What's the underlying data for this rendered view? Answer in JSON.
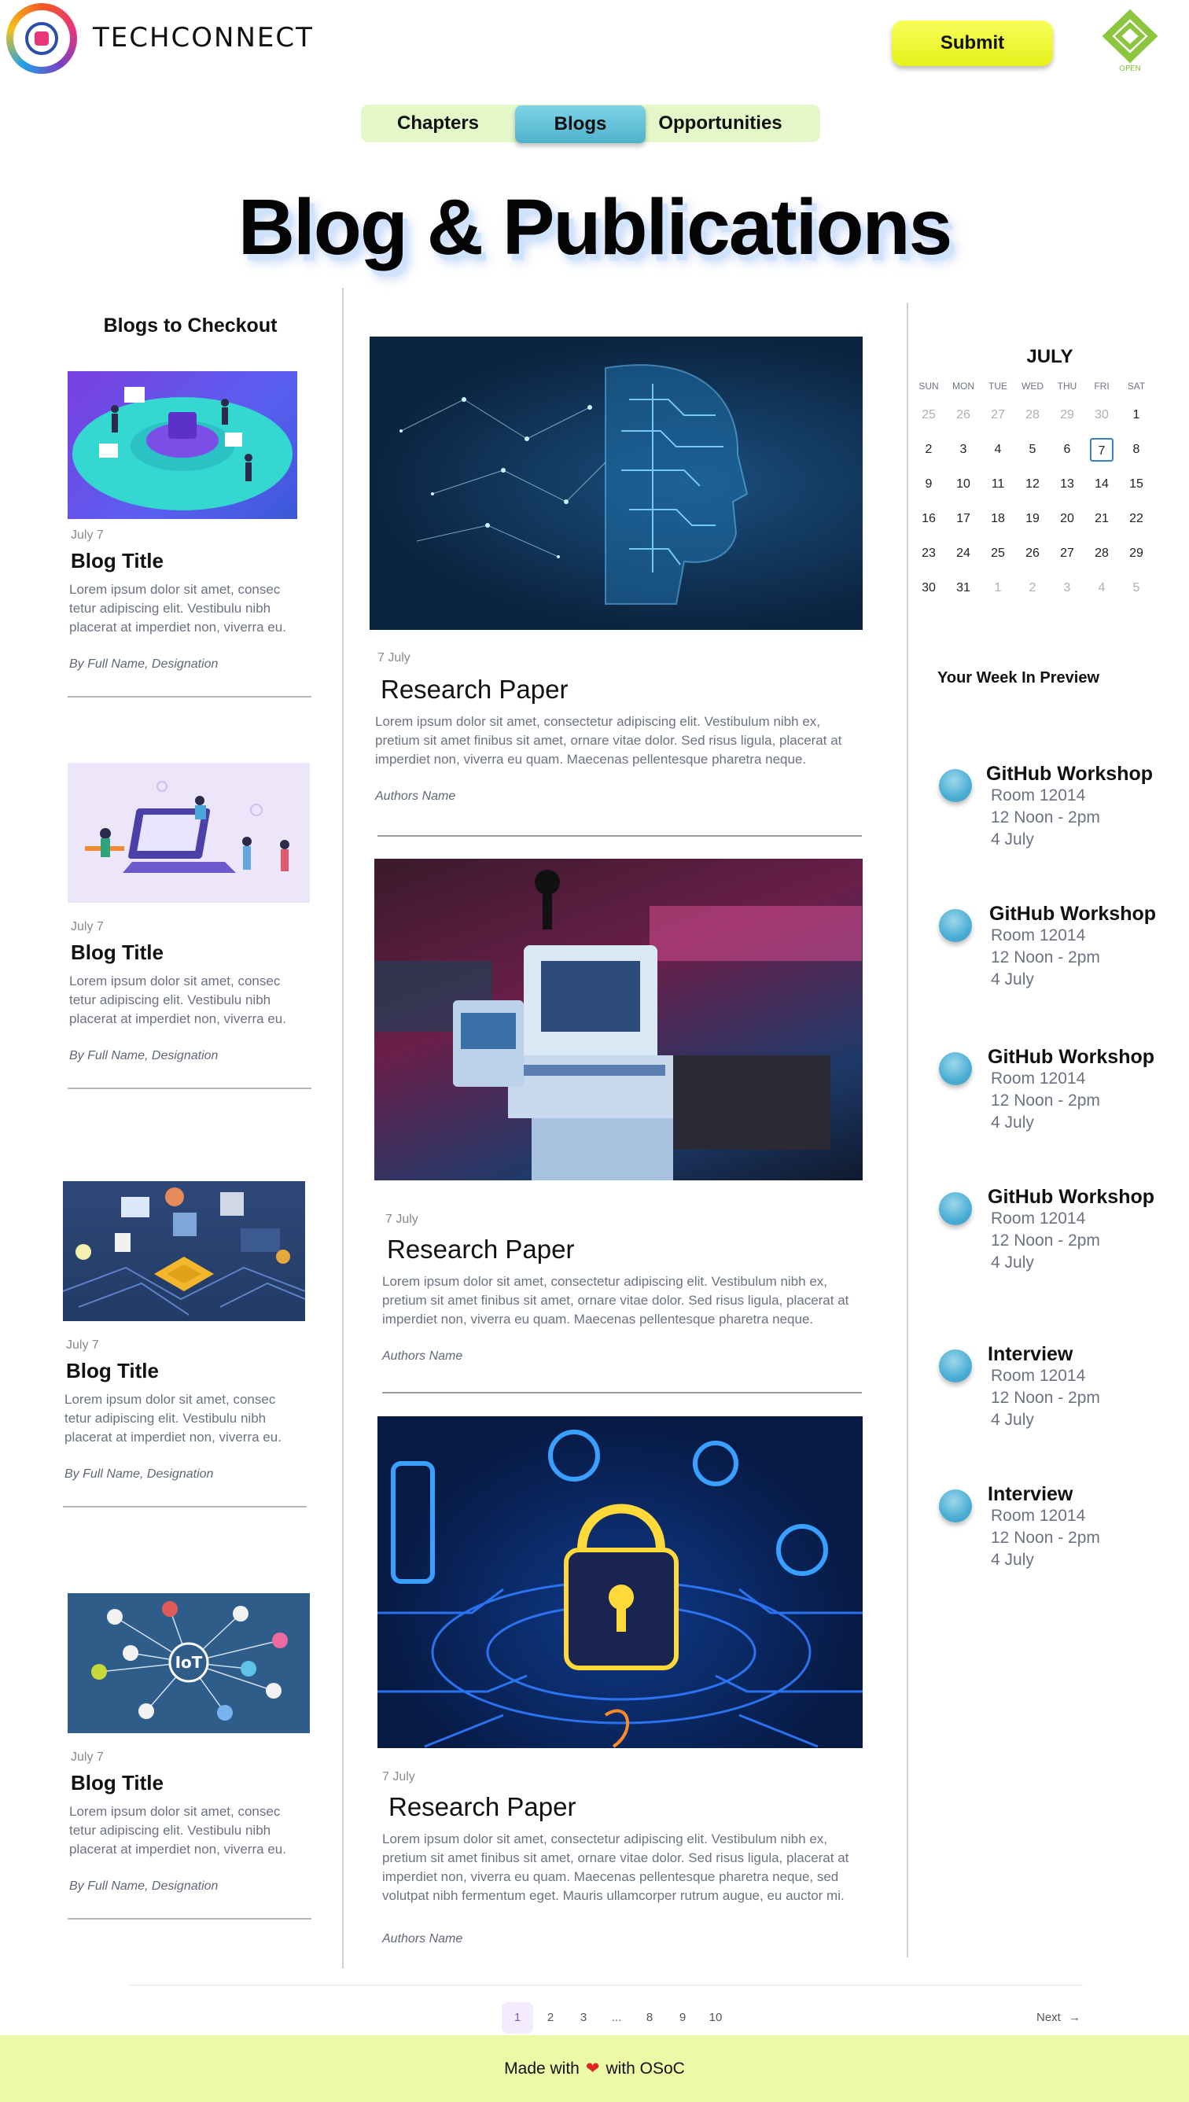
{
  "header": {
    "brand": "TECHCONNECT",
    "submit_label": "Submit",
    "open_logo_text": "OPEN"
  },
  "nav": {
    "tabs": [
      {
        "label": "Chapters",
        "active": false
      },
      {
        "label": "Blogs",
        "active": true
      },
      {
        "label": "Opportunities",
        "active": false
      }
    ]
  },
  "page_title": "Blog & Publications",
  "sidebar": {
    "heading": "Blogs to Checkout",
    "blogs": [
      {
        "date": "July 7",
        "title": "Blog Title",
        "description": "Lorem ipsum dolor sit amet, consec tetur adipiscing elit. Vestibulu nibh placerat at imperdiet non, viverra eu.",
        "author": "By Full Name, Designation"
      },
      {
        "date": "July 7",
        "title": "Blog Title",
        "description": "Lorem ipsum dolor sit amet, consec tetur adipiscing elit. Vestibulu nibh placerat at imperdiet non, viverra eu.",
        "author": "By Full Name, Designation"
      },
      {
        "date": "July 7",
        "title": "Blog Title",
        "description": "Lorem ipsum dolor sit amet, consec tetur adipiscing elit. Vestibulu nibh placerat at imperdiet non, viverra eu.",
        "author": "By Full Name, Designation"
      },
      {
        "date": "July 7",
        "title": "Blog Title",
        "description": "Lorem ipsum dolor sit amet, consec tetur adipiscing elit. Vestibulu nibh placerat at imperdiet non, viverra eu.",
        "author": "By Full Name, Designation"
      }
    ]
  },
  "papers": [
    {
      "date": "7 July",
      "title": "Research Paper",
      "description": "Lorem ipsum dolor sit amet, consectetur adipiscing elit. Vestibulum nibh ex, pretium sit amet finibus sit amet, ornare vitae dolor. Sed risus ligula, placerat at imperdiet non, viverra eu quam. Maecenas pellentesque pharetra neque.",
      "author": "Authors Name"
    },
    {
      "date": "7 July",
      "title": "Research Paper",
      "description": "Lorem ipsum dolor sit amet, consectetur adipiscing elit. Vestibulum nibh ex, pretium sit amet finibus sit amet, ornare vitae dolor. Sed risus ligula, placerat at imperdiet non, viverra eu quam. Maecenas pellentesque pharetra neque.",
      "author": "Authors Name"
    },
    {
      "date": "7 July",
      "title": "Research Paper",
      "description": "Lorem ipsum dolor sit amet, consectetur adipiscing elit. Vestibulum nibh ex, pretium sit amet finibus sit amet, ornare vitae dolor. Sed risus ligula, placerat at imperdiet non, viverra eu quam. Maecenas pellentesque pharetra neque, sed volutpat nibh fermentum eget. Mauris ullamcorper rutrum augue, eu auctor mi.",
      "author": "Authors Name"
    }
  ],
  "calendar": {
    "month": "JULY",
    "weekdays": [
      "SUN",
      "MON",
      "TUE",
      "WED",
      "THU",
      "FRI",
      "SAT"
    ],
    "weeks": [
      [
        "25",
        "26",
        "27",
        "28",
        "29",
        "30",
        "1"
      ],
      [
        "2",
        "3",
        "4",
        "5",
        "6",
        "7",
        "8"
      ],
      [
        "9",
        "10",
        "11",
        "12",
        "13",
        "14",
        "15"
      ],
      [
        "16",
        "17",
        "18",
        "19",
        "20",
        "21",
        "22"
      ],
      [
        "23",
        "24",
        "25",
        "26",
        "27",
        "28",
        "29"
      ],
      [
        "30",
        "31",
        "1",
        "2",
        "3",
        "4",
        "5"
      ]
    ],
    "today": "7"
  },
  "week_preview": {
    "title": "Your Week In Preview",
    "events": [
      {
        "name": "GitHub Workshop",
        "room": "Room 12014",
        "time": "12 Noon - 2pm",
        "date": "4 July"
      },
      {
        "name": "GitHub Workshop",
        "room": "Room 12014",
        "time": "12 Noon - 2pm",
        "date": "4 July"
      },
      {
        "name": "GitHub Workshop",
        "room": "Room 12014",
        "time": "12 Noon - 2pm",
        "date": "4 July"
      },
      {
        "name": "GitHub Workshop",
        "room": "Room 12014",
        "time": "12 Noon - 2pm",
        "date": "4 July"
      },
      {
        "name": "Interview",
        "room": "Room 12014",
        "time": "12 Noon - 2pm",
        "date": "4 July"
      },
      {
        "name": "Interview",
        "room": "Room 12014",
        "time": "12 Noon - 2pm",
        "date": "4 July"
      }
    ]
  },
  "pagination": {
    "pages": [
      "1",
      "2",
      "3",
      "...",
      "8",
      "9",
      "10"
    ],
    "current": "1",
    "next_label": "Next",
    "next_icon": "arrow-right-icon"
  },
  "footer": {
    "before": "Made with",
    "icon": "heart-icon",
    "after": "with OSoC"
  },
  "colors": {
    "submit": "#e6f11b",
    "nav_bg": "#e3f7c8",
    "nav_active": "#4fb2cc",
    "footer_bg": "#ecfaa8",
    "pagination_active": "#7f56d9",
    "heart": "#e02424"
  }
}
